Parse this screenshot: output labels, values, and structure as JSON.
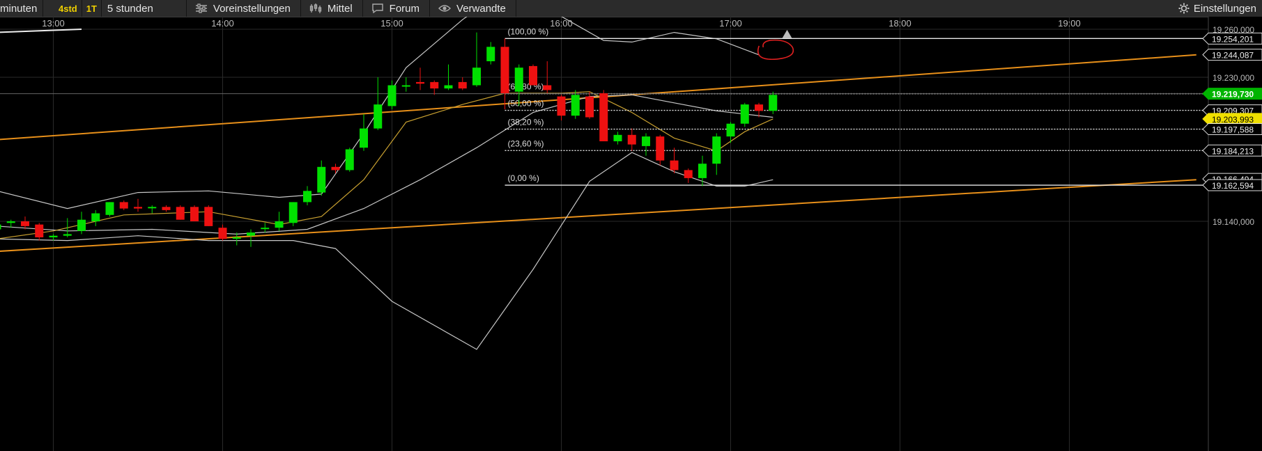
{
  "toolbar": {
    "interval_partial": "minuten",
    "period_4std": "4std",
    "period_1t": "1T",
    "interval_selected": "5 stunden",
    "presets": "Voreinstellungen",
    "indicator": "Mittel",
    "forum": "Forum",
    "related": "Verwandte",
    "settings": "Einstellungen"
  },
  "colors": {
    "up": "#00e000",
    "down": "#ee1111",
    "trendline": "#e8901a",
    "bollinger": "#c8c8c8",
    "moving_average": "#c8a030",
    "current_price_bg": "#00b400",
    "highlight_label_bg": "#f0e000"
  },
  "chart_data": {
    "type": "candlestick",
    "title": "",
    "xlabel": "",
    "ylabel": "",
    "time_ticks": [
      "13:00",
      "14:00",
      "15:00",
      "16:00",
      "17:00",
      "18:00",
      "19:00"
    ],
    "price_ticks": [
      "19.260,000",
      "19.230,000",
      "19.140,000"
    ],
    "ylim": [
      19100,
      19260
    ],
    "grid": true,
    "price_labels": [
      {
        "text": "19.254,201",
        "value": 19254.201,
        "style": "outline"
      },
      {
        "text": "19.244,087",
        "value": 19244.087,
        "style": "outline"
      },
      {
        "text": "19.219,730",
        "value": 19219.73,
        "style": "green"
      },
      {
        "text": "19.209,307",
        "value": 19209.307,
        "style": "outline"
      },
      {
        "text": "19.203,993",
        "value": 19203.993,
        "style": "yellow"
      },
      {
        "text": "19.197,588",
        "value": 19197.588,
        "style": "outline"
      },
      {
        "text": "19.184,213",
        "value": 19184.213,
        "style": "outline"
      },
      {
        "text": "19.166,494",
        "value": 19166.494,
        "style": "outline"
      },
      {
        "text": "19.162,594",
        "value": 19162.594,
        "style": "outline"
      }
    ],
    "fibonacci": [
      {
        "label": "(100,00 %)",
        "value": 19254.201,
        "solid": true
      },
      {
        "label": "(61,80 %)",
        "value": 19219.73,
        "solid": false
      },
      {
        "label": "(50,00 %)",
        "value": 19209.307,
        "solid": false
      },
      {
        "label": "(38,20 %)",
        "value": 19197.588,
        "solid": false
      },
      {
        "label": "(23,60 %)",
        "value": 19184.213,
        "solid": false
      },
      {
        "label": "(0,00 %)",
        "value": 19162.594,
        "solid": true
      }
    ],
    "candles": [
      {
        "t": "12:40",
        "o": 19135,
        "h": 19140,
        "l": 19130,
        "c": 19138
      },
      {
        "t": "12:45",
        "o": 19139,
        "h": 19141,
        "l": 19136,
        "c": 19140
      },
      {
        "t": "12:50",
        "o": 19140,
        "h": 19143,
        "l": 19135,
        "c": 19137
      },
      {
        "t": "12:55",
        "o": 19138,
        "h": 19139,
        "l": 19128,
        "c": 19130
      },
      {
        "t": "13:00",
        "o": 19130,
        "h": 19132,
        "l": 19128,
        "c": 19131
      },
      {
        "t": "13:05",
        "o": 19131,
        "h": 19142,
        "l": 19130,
        "c": 19132
      },
      {
        "t": "13:10",
        "o": 19134,
        "h": 19146,
        "l": 19132,
        "c": 19141
      },
      {
        "t": "13:15",
        "o": 19140,
        "h": 19147,
        "l": 19137,
        "c": 19145
      },
      {
        "t": "13:20",
        "o": 19144,
        "h": 19152,
        "l": 19143,
        "c": 19152
      },
      {
        "t": "13:25",
        "o": 19152,
        "h": 19153,
        "l": 19147,
        "c": 19148
      },
      {
        "t": "13:30",
        "o": 19149,
        "h": 19154,
        "l": 19146,
        "c": 19148
      },
      {
        "t": "13:35",
        "o": 19149,
        "h": 19150,
        "l": 19145,
        "c": 19149
      },
      {
        "t": "13:40",
        "o": 19149,
        "h": 19150,
        "l": 19146,
        "c": 19147
      },
      {
        "t": "13:45",
        "o": 19149,
        "h": 19150,
        "l": 19141,
        "c": 19141
      },
      {
        "t": "13:50",
        "o": 19149,
        "h": 19150,
        "l": 19140,
        "c": 19140
      },
      {
        "t": "13:55",
        "o": 19149,
        "h": 19150,
        "l": 19137,
        "c": 19137
      },
      {
        "t": "14:00",
        "o": 19136,
        "h": 19138,
        "l": 19128,
        "c": 19129
      },
      {
        "t": "14:05",
        "o": 19130,
        "h": 19133,
        "l": 19125,
        "c": 19130
      },
      {
        "t": "14:10",
        "o": 19131,
        "h": 19135,
        "l": 19124,
        "c": 19133
      },
      {
        "t": "14:15",
        "o": 19136,
        "h": 19139,
        "l": 19133,
        "c": 19136
      },
      {
        "t": "14:20",
        "o": 19136,
        "h": 19146,
        "l": 19134,
        "c": 19140
      },
      {
        "t": "14:25",
        "o": 19139,
        "h": 19152,
        "l": 19137,
        "c": 19152
      },
      {
        "t": "14:30",
        "o": 19152,
        "h": 19162,
        "l": 19150,
        "c": 19159
      },
      {
        "t": "14:35",
        "o": 19158,
        "h": 19178,
        "l": 19156,
        "c": 19174
      },
      {
        "t": "14:40",
        "o": 19174,
        "h": 19176,
        "l": 19170,
        "c": 19172
      },
      {
        "t": "14:45",
        "o": 19172,
        "h": 19186,
        "l": 19171,
        "c": 19185
      },
      {
        "t": "14:50",
        "o": 19186,
        "h": 19207,
        "l": 19184,
        "c": 19198
      },
      {
        "t": "14:55",
        "o": 19198,
        "h": 19230,
        "l": 19197,
        "c": 19213
      },
      {
        "t": "15:00",
        "o": 19212,
        "h": 19228,
        "l": 19210,
        "c": 19225
      },
      {
        "t": "15:05",
        "o": 19225,
        "h": 19230,
        "l": 19221,
        "c": 19225
      },
      {
        "t": "15:10",
        "o": 19227,
        "h": 19236,
        "l": 19222,
        "c": 19226
      },
      {
        "t": "15:15",
        "o": 19227,
        "h": 19228,
        "l": 19219,
        "c": 19223
      },
      {
        "t": "15:20",
        "o": 19223,
        "h": 19238,
        "l": 19222,
        "c": 19225
      },
      {
        "t": "15:25",
        "o": 19227,
        "h": 19230,
        "l": 19222,
        "c": 19223
      },
      {
        "t": "15:30",
        "o": 19225,
        "h": 19258,
        "l": 19224,
        "c": 19236
      },
      {
        "t": "15:35",
        "o": 19240,
        "h": 19252,
        "l": 19238,
        "c": 19249
      },
      {
        "t": "15:40",
        "o": 19249,
        "h": 19251,
        "l": 19210,
        "c": 19220
      },
      {
        "t": "15:45",
        "o": 19221,
        "h": 19238,
        "l": 19212,
        "c": 19236
      },
      {
        "t": "15:50",
        "o": 19237,
        "h": 19238,
        "l": 19225,
        "c": 19225
      },
      {
        "t": "15:55",
        "o": 19225,
        "h": 19240,
        "l": 19220,
        "c": 19222
      },
      {
        "t": "16:00",
        "o": 19218,
        "h": 19219,
        "l": 19203,
        "c": 19206
      },
      {
        "t": "16:05",
        "o": 19206,
        "h": 19222,
        "l": 19204,
        "c": 19219
      },
      {
        "t": "16:10",
        "o": 19218,
        "h": 19221,
        "l": 19204,
        "c": 19205
      },
      {
        "t": "16:15",
        "o": 19220,
        "h": 19222,
        "l": 19190,
        "c": 19190
      },
      {
        "t": "16:20",
        "o": 19190,
        "h": 19196,
        "l": 19188,
        "c": 19194
      },
      {
        "t": "16:25",
        "o": 19194,
        "h": 19198,
        "l": 19184,
        "c": 19188
      },
      {
        "t": "16:30",
        "o": 19187,
        "h": 19195,
        "l": 19181,
        "c": 19193
      },
      {
        "t": "16:35",
        "o": 19193,
        "h": 19194,
        "l": 19175,
        "c": 19178
      },
      {
        "t": "16:40",
        "o": 19178,
        "h": 19186,
        "l": 19170,
        "c": 19172
      },
      {
        "t": "16:45",
        "o": 19172,
        "h": 19173,
        "l": 19164,
        "c": 19167
      },
      {
        "t": "16:50",
        "o": 19167,
        "h": 19181,
        "l": 19162,
        "c": 19176
      },
      {
        "t": "16:55",
        "o": 19176,
        "h": 19195,
        "l": 19169,
        "c": 19193
      },
      {
        "t": "17:00",
        "o": 19193,
        "h": 19202,
        "l": 19189,
        "c": 19201
      },
      {
        "t": "17:05",
        "o": 19201,
        "h": 19214,
        "l": 19199,
        "c": 19213
      },
      {
        "t": "17:10",
        "o": 19213,
        "h": 19214,
        "l": 19205,
        "c": 19209
      },
      {
        "t": "17:15",
        "o": 19209,
        "h": 19221,
        "l": 19207,
        "c": 19219
      }
    ],
    "moving_average": [
      {
        "t": "12:40",
        "v": 19129
      },
      {
        "t": "13:00",
        "v": 19134
      },
      {
        "t": "13:25",
        "v": 19144
      },
      {
        "t": "13:55",
        "v": 19146
      },
      {
        "t": "14:20",
        "v": 19138
      },
      {
        "t": "14:35",
        "v": 19143
      },
      {
        "t": "14:50",
        "v": 19166
      },
      {
        "t": "15:05",
        "v": 19202
      },
      {
        "t": "15:25",
        "v": 19213
      },
      {
        "t": "15:40",
        "v": 19220
      },
      {
        "t": "16:00",
        "v": 19220
      },
      {
        "t": "16:10",
        "v": 19221
      },
      {
        "t": "16:25",
        "v": 19208
      },
      {
        "t": "16:40",
        "v": 19192
      },
      {
        "t": "16:55",
        "v": 19184
      },
      {
        "t": "17:05",
        "v": 19196
      },
      {
        "t": "17:15",
        "v": 19204
      }
    ],
    "bollinger_upper": [
      {
        "t": "12:40",
        "v": 19159
      },
      {
        "t": "13:05",
        "v": 19148
      },
      {
        "t": "13:30",
        "v": 19158
      },
      {
        "t": "13:55",
        "v": 19159
      },
      {
        "t": "14:20",
        "v": 19155
      },
      {
        "t": "14:35",
        "v": 19157
      },
      {
        "t": "14:50",
        "v": 19195
      },
      {
        "t": "15:05",
        "v": 19236
      },
      {
        "t": "15:25",
        "v": 19266
      },
      {
        "t": "15:40",
        "v": 19285
      },
      {
        "t": "16:00",
        "v": 19268
      },
      {
        "t": "16:15",
        "v": 19253
      },
      {
        "t": "16:25",
        "v": 19252
      },
      {
        "t": "16:40",
        "v": 19258
      },
      {
        "t": "16:55",
        "v": 19254
      },
      {
        "t": "17:10",
        "v": 19244
      }
    ],
    "bollinger_lower": [
      {
        "t": "12:40",
        "v": 19129
      },
      {
        "t": "13:05",
        "v": 19128
      },
      {
        "t": "13:30",
        "v": 19131
      },
      {
        "t": "13:55",
        "v": 19128
      },
      {
        "t": "14:10",
        "v": 19128
      },
      {
        "t": "14:25",
        "v": 19128
      },
      {
        "t": "14:40",
        "v": 19123
      },
      {
        "t": "15:00",
        "v": 19090
      },
      {
        "t": "15:30",
        "v": 19060
      },
      {
        "t": "15:50",
        "v": 19110
      },
      {
        "t": "16:10",
        "v": 19165
      },
      {
        "t": "16:25",
        "v": 19183
      },
      {
        "t": "16:40",
        "v": 19171
      },
      {
        "t": "16:55",
        "v": 19162
      },
      {
        "t": "17:05",
        "v": 19162
      },
      {
        "t": "17:15",
        "v": 19166
      }
    ],
    "bollinger_mid": [
      {
        "t": "12:40",
        "v": 19137
      },
      {
        "t": "13:05",
        "v": 19134
      },
      {
        "t": "13:35",
        "v": 19135
      },
      {
        "t": "14:05",
        "v": 19132
      },
      {
        "t": "14:30",
        "v": 19135
      },
      {
        "t": "14:50",
        "v": 19148
      },
      {
        "t": "15:10",
        "v": 19166
      },
      {
        "t": "15:30",
        "v": 19186
      },
      {
        "t": "15:50",
        "v": 19208
      },
      {
        "t": "16:10",
        "v": 19218
      },
      {
        "t": "16:25",
        "v": 19219
      },
      {
        "t": "16:40",
        "v": 19214
      },
      {
        "t": "16:55",
        "v": 19209
      },
      {
        "t": "17:15",
        "v": 19205
      }
    ],
    "trendlines": [
      {
        "from": {
          "t": "12:00",
          "v": 19186
        },
        "to": {
          "t": "19:45",
          "v": 19244
        }
      },
      {
        "from": {
          "t": "12:00",
          "v": 19117
        },
        "to": {
          "t": "19:45",
          "v": 19166
        }
      }
    ],
    "tail_line": {
      "from": {
        "t": "12:40",
        "v": 19258
      },
      "to": {
        "t": "13:10",
        "v": 19260
      }
    },
    "annotation": {
      "type": "hand-drawn-circle",
      "at": {
        "t": "17:15",
        "v": 19247
      }
    },
    "marker": {
      "type": "triangle-up",
      "at": {
        "t": "17:20",
        "v": 19257
      }
    }
  }
}
